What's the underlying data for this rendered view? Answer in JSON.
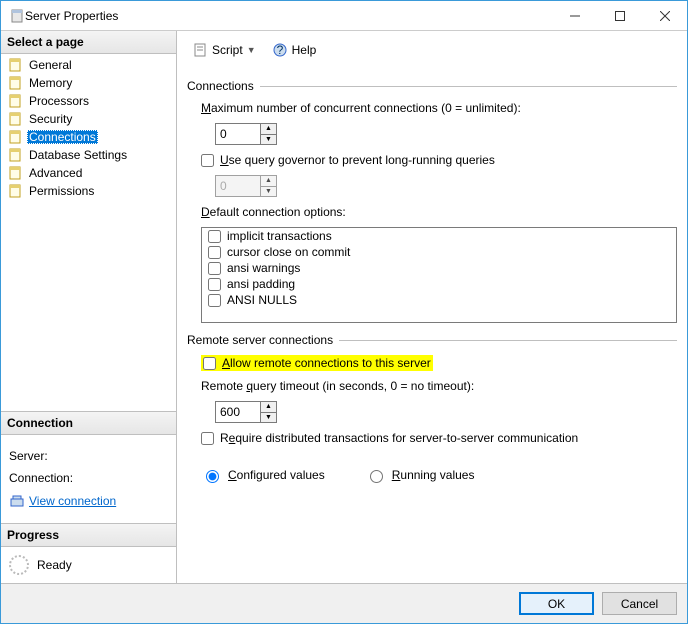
{
  "window": {
    "title": "Server Properties"
  },
  "toolbar": {
    "script": "Script",
    "help": "Help"
  },
  "sidebar": {
    "select_page": "Select a page",
    "pages": [
      {
        "label": "General"
      },
      {
        "label": "Memory"
      },
      {
        "label": "Processors"
      },
      {
        "label": "Security"
      },
      {
        "label": "Connections",
        "selected": true
      },
      {
        "label": "Database Settings"
      },
      {
        "label": "Advanced"
      },
      {
        "label": "Permissions"
      }
    ],
    "connection_header": "Connection",
    "server_label": "Server:",
    "connection_label": "Connection:",
    "view_connection": "View connection ",
    "progress_header": "Progress",
    "progress_status": "Ready"
  },
  "main": {
    "group_connections": "Connections",
    "max_conn_label": "Maximum number of concurrent connections (0 = unlimited):",
    "max_conn_value": "0",
    "query_governor_label": "Use query governor to prevent long-running queries",
    "query_governor_value": "0",
    "default_options_label": "Default connection options:",
    "options": [
      "implicit transactions",
      "cursor close on commit",
      "ansi warnings",
      "ansi padding",
      "ANSI NULLS"
    ],
    "group_remote": "Remote server connections",
    "allow_remote_label": "Allow remote connections to this server",
    "remote_timeout_label": "Remote query timeout (in seconds, 0 = no timeout):",
    "remote_timeout_value": "600",
    "require_dtc_label": "Require distributed transactions for server-to-server communication",
    "configured_label": "Configured values",
    "running_label": "Running values"
  },
  "footer": {
    "ok": "OK",
    "cancel": "Cancel"
  }
}
